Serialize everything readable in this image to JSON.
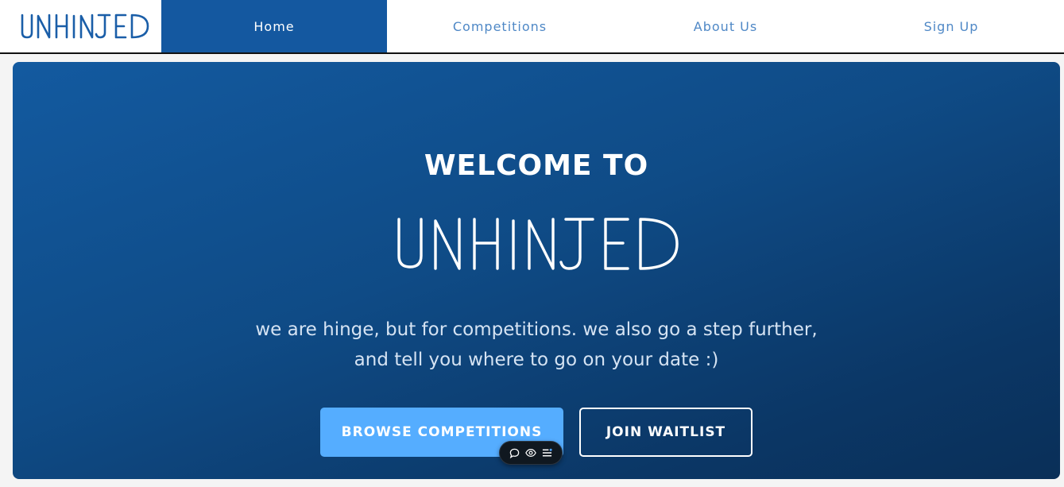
{
  "nav": {
    "logo_text": "UNHINJED",
    "items": [
      {
        "label": "Home",
        "active": true
      },
      {
        "label": "Competitions",
        "active": false
      },
      {
        "label": "About Us",
        "active": false
      },
      {
        "label": "Sign Up",
        "active": false
      }
    ]
  },
  "hero": {
    "welcome": "WELCOME TO",
    "brand": "UNHINJED",
    "tagline_line1": "we are hinge, but for competitions. we also go a step further,",
    "tagline_line2": "and tell you where to go on your date :)",
    "browse_label": "BROWSE COMPETITIONS",
    "join_label": "JOIN WAITLIST"
  },
  "toolbar": {
    "icons": [
      "comment-icon",
      "eye-icon",
      "list-icon"
    ]
  },
  "colors": {
    "nav_active_bg": "#1458a0",
    "nav_text": "#4f88c6",
    "hero_start": "#135aa0",
    "hero_end": "#0a2f58",
    "browse_bg": "#55adff"
  }
}
